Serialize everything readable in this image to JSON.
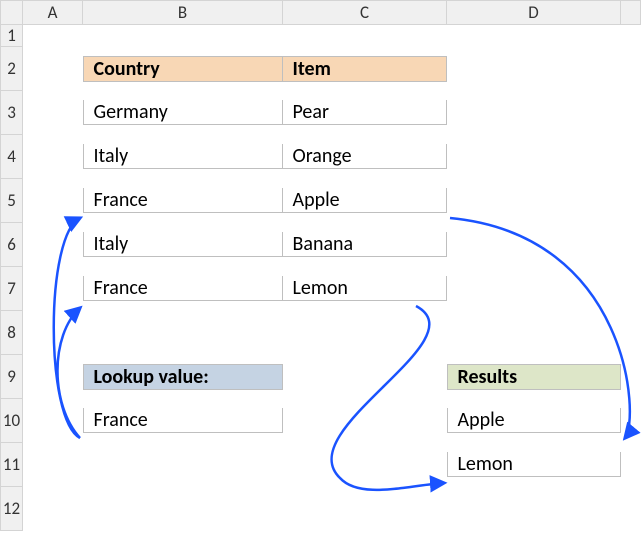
{
  "columns": {
    "A": "A",
    "B": "B",
    "C": "C",
    "D": "D"
  },
  "rows": [
    "1",
    "2",
    "3",
    "4",
    "5",
    "6",
    "7",
    "8",
    "9",
    "10",
    "11",
    "12"
  ],
  "table1": {
    "header": {
      "country": "Country",
      "item": "Item"
    },
    "rows": [
      {
        "country": "Germany",
        "item": "Pear"
      },
      {
        "country": "Italy",
        "item": "Orange"
      },
      {
        "country": "France",
        "item": "Apple"
      },
      {
        "country": "Italy",
        "item": "Banana"
      },
      {
        "country": "France",
        "item": "Lemon"
      }
    ]
  },
  "lookup": {
    "label": "Lookup value:",
    "value": "France"
  },
  "results": {
    "label": "Results",
    "values": [
      "Apple",
      "Lemon"
    ]
  },
  "arrow_color": "#1a53ff"
}
